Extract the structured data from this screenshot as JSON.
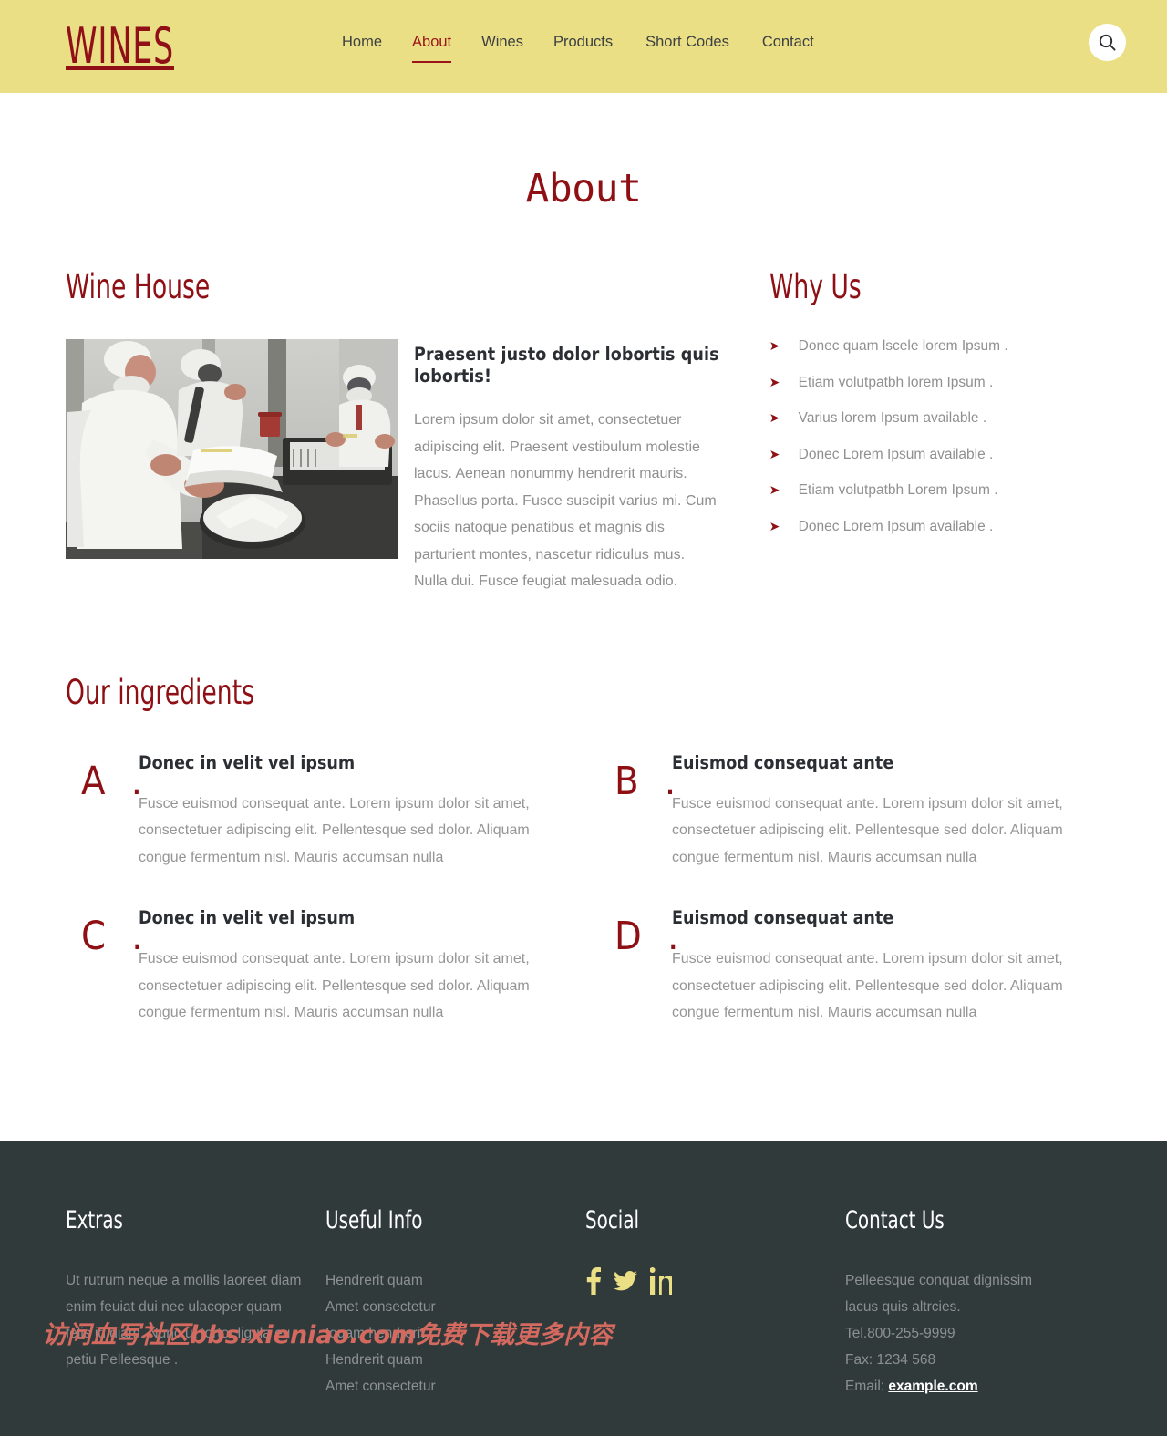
{
  "header": {
    "logo": "WINES",
    "nav": [
      {
        "label": "Home",
        "active": false
      },
      {
        "label": "About",
        "active": true
      },
      {
        "label": "Wines",
        "active": false
      },
      {
        "label": "Products",
        "active": false
      },
      {
        "label": "Short Codes",
        "active": false
      },
      {
        "label": "Contact",
        "active": false
      }
    ],
    "search_icon": "search-icon",
    "bg_color": "#ebdf85",
    "accent_color": "#9b1419"
  },
  "page": {
    "title": "About"
  },
  "wine_house": {
    "title": "Wine House",
    "image_alt": "Workers in white coats and hairnets packing food in a processing facility",
    "sub_head": "Praesent justo dolor lobortis quis lobortis!",
    "paragraph": "Lorem ipsum dolor sit amet, consectetuer adipiscing elit. Praesent vestibulum molestie lacus. Aenean nonummy hendrerit mauris. Phasellus porta. Fusce suscipit varius mi. Cum sociis natoque penatibus et magnis dis parturient montes, nascetur ridiculus mus. Nulla dui. Fusce feugiat malesuada odio."
  },
  "why_us": {
    "title": "Why Us",
    "bullet_glyph": "➤",
    "items": [
      "Donec quam lscele lorem Ipsum .",
      "Etiam volutpatbh lorem Ipsum .",
      "Varius lorem Ipsum available .",
      "Donec Lorem Ipsum available .",
      "Etiam volutpatbh Lorem Ipsum .",
      "Donec Lorem Ipsum available ."
    ]
  },
  "ingredients": {
    "title": "Our ingredients",
    "items": [
      {
        "letter": "A .",
        "title": "Donec in velit vel ipsum",
        "desc": "Fusce euismod consequat ante. Lorem ipsum dolor sit amet, consectetuer adipiscing elit. Pellentesque sed dolor. Aliquam congue fermentum nisl. Mauris accumsan nulla"
      },
      {
        "letter": "B .",
        "title": "Euismod consequat ante",
        "desc": "Fusce euismod consequat ante. Lorem ipsum dolor sit amet, consectetuer adipiscing elit. Pellentesque sed dolor. Aliquam congue fermentum nisl. Mauris accumsan nulla"
      },
      {
        "letter": "C .",
        "title": "Donec in velit vel ipsum",
        "desc": "Fusce euismod consequat ante. Lorem ipsum dolor sit amet, consectetuer adipiscing elit. Pellentesque sed dolor. Aliquam congue fermentum nisl. Mauris accumsan nulla"
      },
      {
        "letter": "D .",
        "title": "Euismod consequat ante",
        "desc": "Fusce euismod consequat ante. Lorem ipsum dolor sit amet, consectetuer adipiscing elit. Pellentesque sed dolor. Aliquam congue fermentum nisl. Mauris accumsan nulla"
      }
    ]
  },
  "footer": {
    "bg_color": "#313a3b",
    "extras": {
      "title": "Extras",
      "text": "Ut rutrum neque a mollis laoreet diam enim feuiat dui nec ulacoper quam felis id diam. Nunc ut tortor ligula eu petiu Pelleesque ."
    },
    "useful_info": {
      "title": "Useful Info",
      "links": [
        "Hendrerit quam",
        "Amet consectetur",
        "Iquam hendrerit",
        "Hendrerit quam",
        "Amet consectetur"
      ]
    },
    "social": {
      "title": "Social",
      "icons": [
        "facebook-icon",
        "twitter-icon",
        "linkedin-icon"
      ],
      "icon_color": "#ebdf85"
    },
    "contact": {
      "title": "Contact Us",
      "line1": "Pelleesque conquat dignissim",
      "line2": "lacus quis altrcies.",
      "tel": "Tel.800-255-9999",
      "fax": "Fax: 1234 568",
      "email_label": "Email:",
      "email_value": "example.com"
    }
  },
  "watermark": {
    "text": "访问血写社区bbs.xieniao.com免费下载更多内容"
  }
}
